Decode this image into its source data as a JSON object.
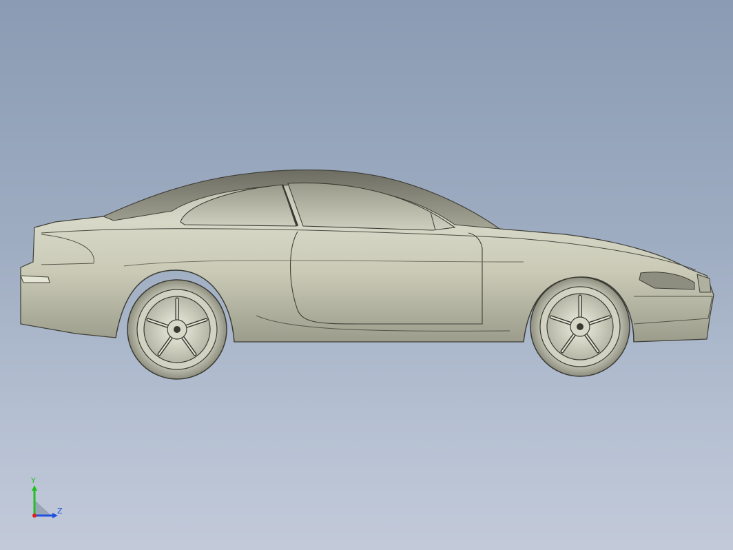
{
  "viewport": {
    "background_top": "#8a9bb3",
    "background_bottom": "#c2cad9"
  },
  "model": {
    "icon": "car-model",
    "view": "side"
  },
  "triad": {
    "y_label": "Y",
    "z_label": "Z",
    "x_color": "#e02020",
    "y_color": "#22c022",
    "z_color": "#2050e0"
  }
}
